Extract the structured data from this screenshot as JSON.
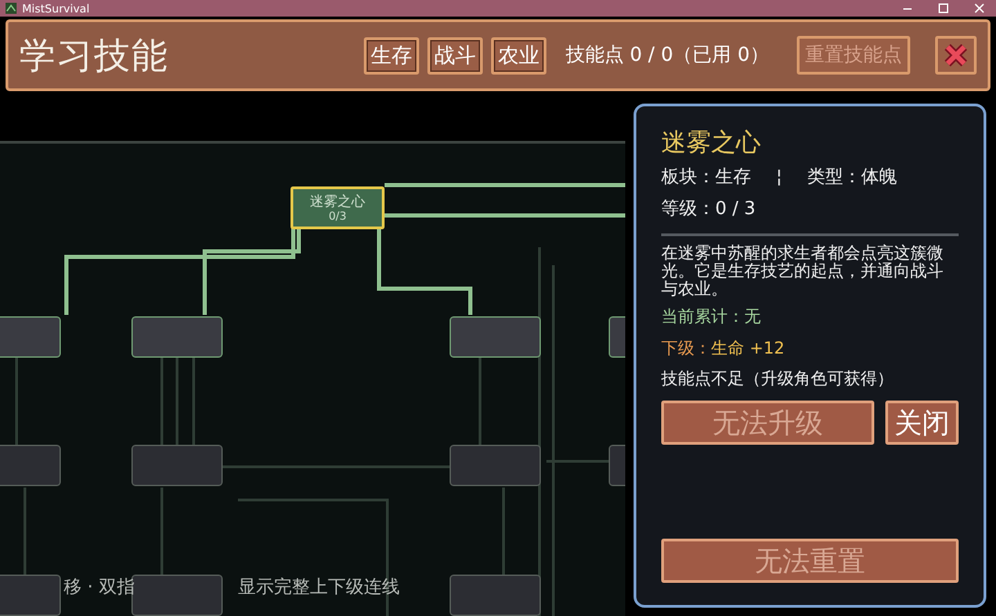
{
  "window": {
    "title": "MistSurvival"
  },
  "header": {
    "title": "学习技能",
    "tabs": [
      {
        "label": "生存",
        "selected": false
      },
      {
        "label": "战斗",
        "selected": false
      },
      {
        "label": "农业",
        "selected": false
      }
    ],
    "skill_points": "技能点 0 / 0（已用 0）",
    "reset_button": {
      "label": "重置技能点",
      "disabled": true
    }
  },
  "tree": {
    "nodes": [
      {
        "label": "迷雾之心",
        "level": "0/3",
        "selected": true
      }
    ],
    "hint_parts": [
      "移 · 双指",
      "显示完整上下级连线"
    ]
  },
  "panel": {
    "title": "迷雾之心",
    "block": "板块：生存",
    "separator": "¦",
    "type": "类型：体魄",
    "level": "等级：0 / 3",
    "description": "在迷雾中苏醒的求生者都会点亮这簇微光。它是生存技艺的起点，并通向战斗与农业。",
    "current": "当前累计：无",
    "next_label": "下级：",
    "next_value": "生命 +12",
    "notice": "技能点不足（升级角色可获得）",
    "upgrade_button": {
      "label": "无法升级",
      "disabled": true
    },
    "close_button": {
      "label": "关闭",
      "disabled": false
    },
    "reset_button": {
      "label": "无法重置",
      "disabled": true
    }
  }
}
